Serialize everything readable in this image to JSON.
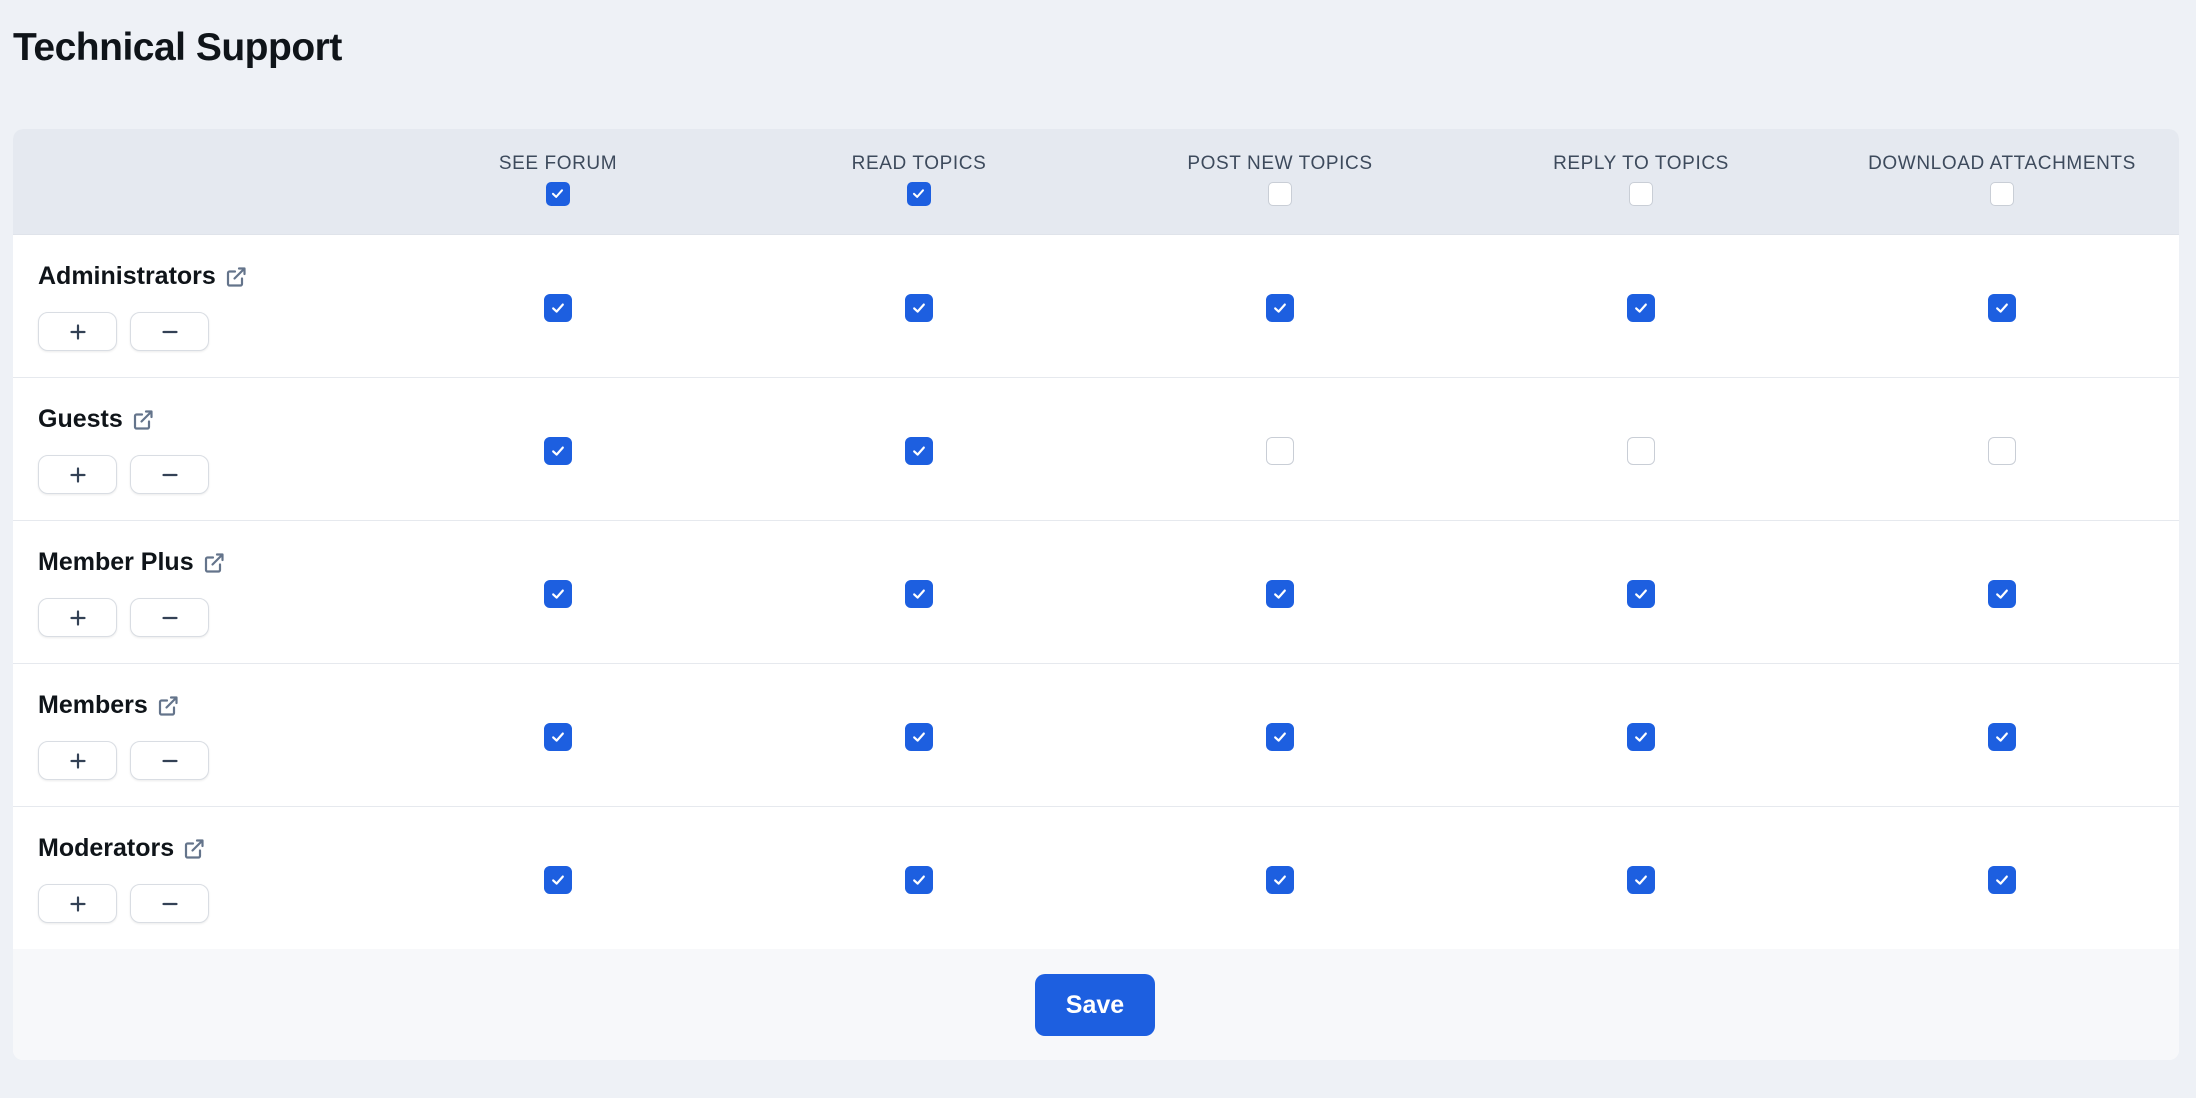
{
  "page": {
    "title": "Technical Support"
  },
  "columns": [
    {
      "label": "SEE FORUM",
      "all_checked": true
    },
    {
      "label": "READ TOPICS",
      "all_checked": true
    },
    {
      "label": "POST NEW TOPICS",
      "all_checked": false
    },
    {
      "label": "REPLY TO TOPICS",
      "all_checked": false
    },
    {
      "label": "DOWNLOAD ATTACHMENTS",
      "all_checked": false
    }
  ],
  "groups": [
    {
      "name": "Administrators",
      "permissions": [
        true,
        true,
        true,
        true,
        true
      ]
    },
    {
      "name": "Guests",
      "permissions": [
        true,
        true,
        false,
        false,
        false
      ]
    },
    {
      "name": "Member Plus",
      "permissions": [
        true,
        true,
        true,
        true,
        true
      ]
    },
    {
      "name": "Members",
      "permissions": [
        true,
        true,
        true,
        true,
        true
      ]
    },
    {
      "name": "Moderators",
      "permissions": [
        true,
        true,
        true,
        true,
        true
      ]
    }
  ],
  "actions": {
    "save_label": "Save",
    "add_icon": "plus-icon",
    "remove_icon": "minus-icon",
    "link_icon": "external-link-icon"
  },
  "colors": {
    "accent": "#1d5fe0",
    "background": "#eef1f6",
    "header_bg": "#e5e9f0"
  }
}
